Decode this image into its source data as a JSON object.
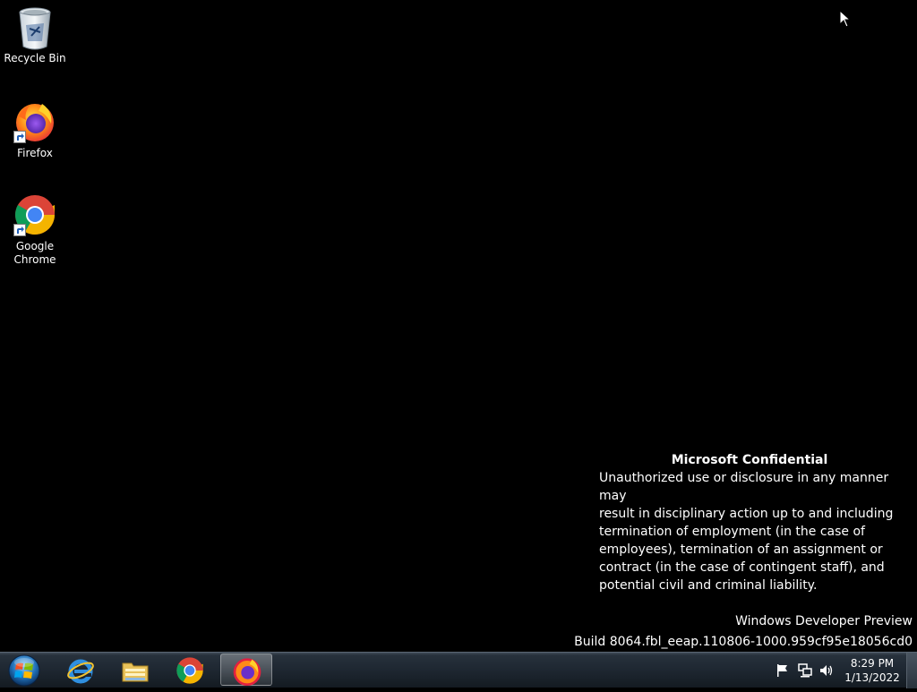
{
  "desktop": {
    "icons": [
      {
        "label": "Recycle Bin",
        "icon": "recycle-bin-icon"
      },
      {
        "label": "Firefox",
        "icon": "firefox-icon",
        "shortcut": true
      },
      {
        "label_line1": "Google",
        "label_line2": "Chrome",
        "icon": "chrome-icon",
        "shortcut": true
      }
    ]
  },
  "watermark": {
    "title": "Microsoft Confidential",
    "lines": [
      "Unauthorized use or disclosure in any manner may",
      "result in disciplinary action up to and including",
      "termination of employment (in the case of",
      "employees), termination of an assignment or",
      "contract (in the case of contingent staff), and",
      "potential civil and criminal liability."
    ]
  },
  "build_info": {
    "product": "Windows Developer Preview",
    "build": "Build 8064.fbl_eeap.110806-1000.959cf95e18056cd0"
  },
  "taskbar": {
    "start": {
      "icon": "windows-start-orb-icon"
    },
    "pinned": [
      {
        "app": "Internet Explorer",
        "icon": "internet-explorer-icon",
        "active": false
      },
      {
        "app": "Windows Explorer",
        "icon": "folder-explorer-icon",
        "active": false
      },
      {
        "app": "Google Chrome",
        "icon": "chrome-icon",
        "active": false
      },
      {
        "app": "Firefox",
        "icon": "firefox-icon",
        "active": true
      }
    ],
    "tray": {
      "icons": [
        "action-center-flag-icon",
        "network-icon",
        "volume-icon"
      ],
      "time": "8:29 PM",
      "date": "1/13/2022"
    }
  },
  "colors": {
    "desktop_background": "#000000",
    "taskbar": "#1e2731",
    "text": "#ffffff"
  }
}
